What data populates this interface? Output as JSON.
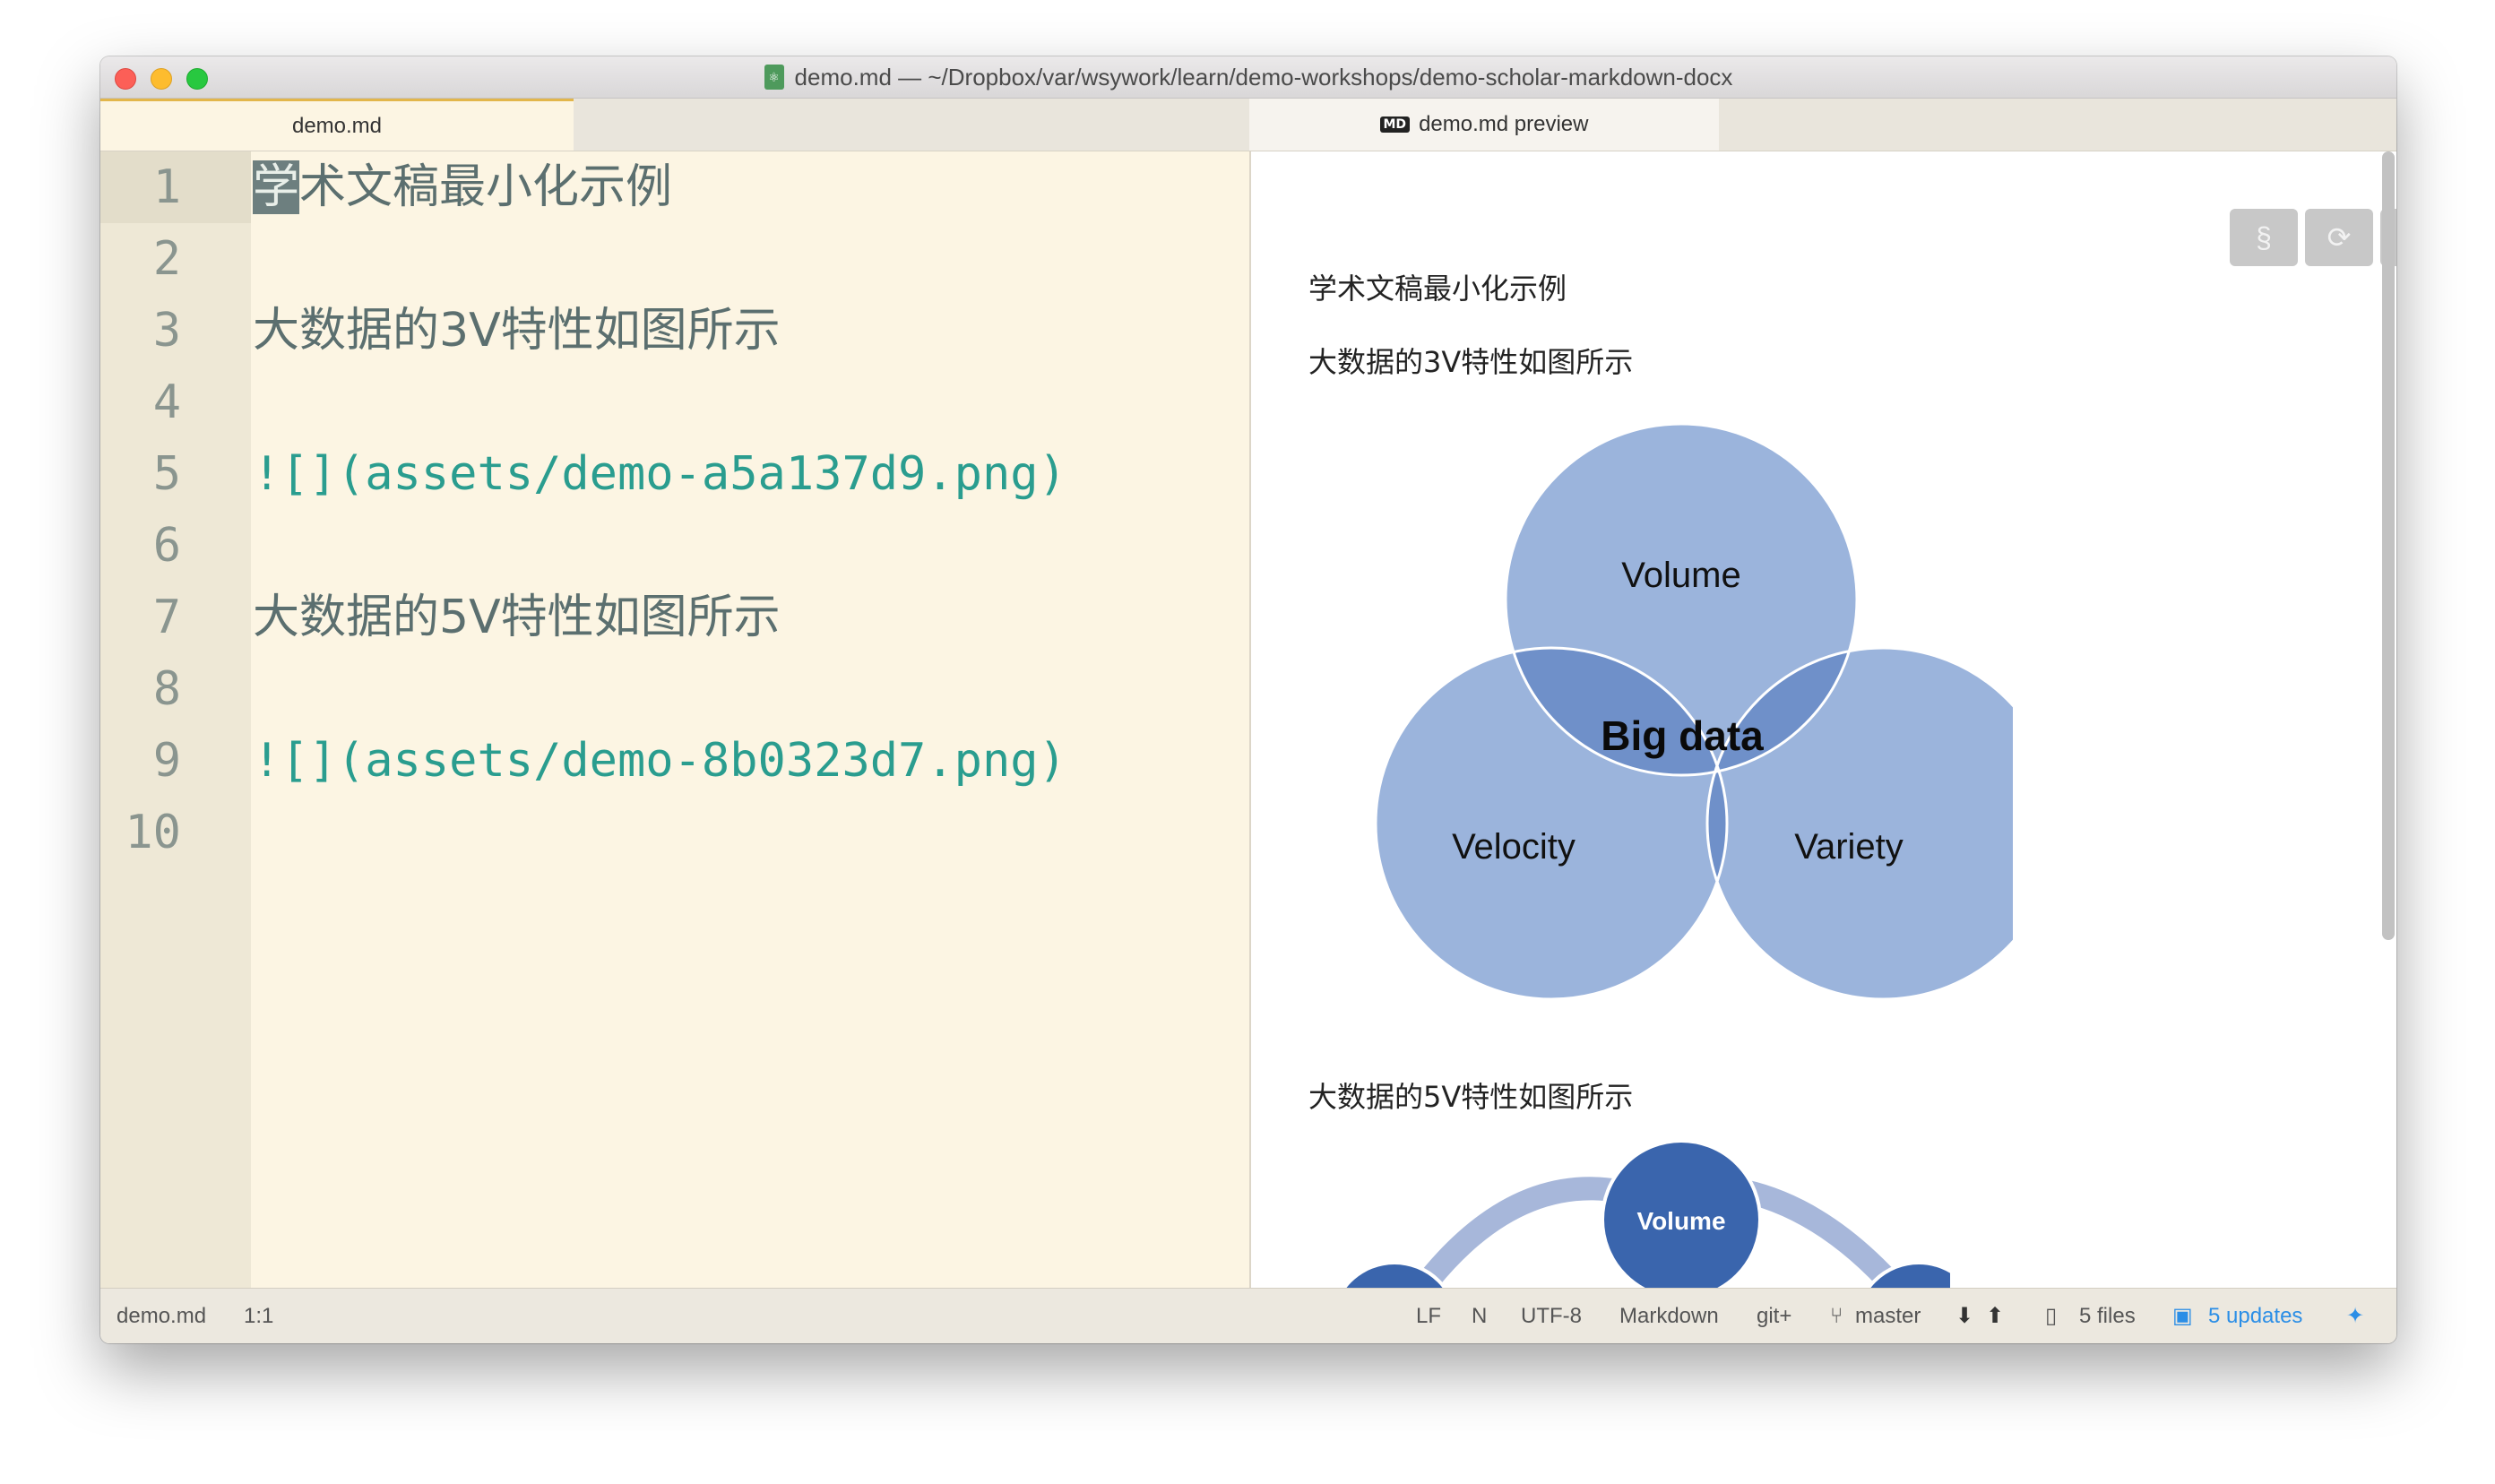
{
  "window": {
    "title": "demo.md — ~/Dropbox/var/wsywork/learn/demo-workshops/demo-scholar-markdown-docx"
  },
  "tabs": {
    "editor": "demo.md",
    "preview": "demo.md preview",
    "preview_badge": "MD"
  },
  "editor": {
    "line_numbers": [
      "1",
      "2",
      "3",
      "4",
      "5",
      "6",
      "7",
      "8",
      "9",
      "10"
    ],
    "lines": [
      {
        "cursor": "学",
        "rest": "术文稿最小化示例"
      },
      {
        "text": "大数据的3V特性如图所示"
      },
      {
        "text": "![](assets/demo-a5a137d9.png)"
      },
      {
        "text": "大数据的5V特性如图所示"
      },
      {
        "text": "![](assets/demo-8b0323d7.png)"
      }
    ]
  },
  "preview": {
    "title": "学术文稿最小化示例",
    "para1": "大数据的3V特性如图所示",
    "para2": "大数据的5V特性如图所示",
    "toolbar": {
      "section": "§",
      "refresh": "⟳",
      "up": "⬆"
    },
    "venn": {
      "top": "Volume",
      "left": "Velocity",
      "right": "Variety",
      "center": "Big data",
      "fill_color": "#8eaad6",
      "overlap_color": "#6e8fc8"
    },
    "five_v": {
      "top": "Volume",
      "node_color": "#3a65ad",
      "ring_color": "#a7b7da"
    }
  },
  "statusbar": {
    "file": "demo.md",
    "position": "1:1",
    "line_ending": "LF",
    "n": "N",
    "encoding": "UTF-8",
    "grammar": "Markdown",
    "git": "git+",
    "branch": "master",
    "files": "5 files",
    "updates": "5 updates"
  }
}
